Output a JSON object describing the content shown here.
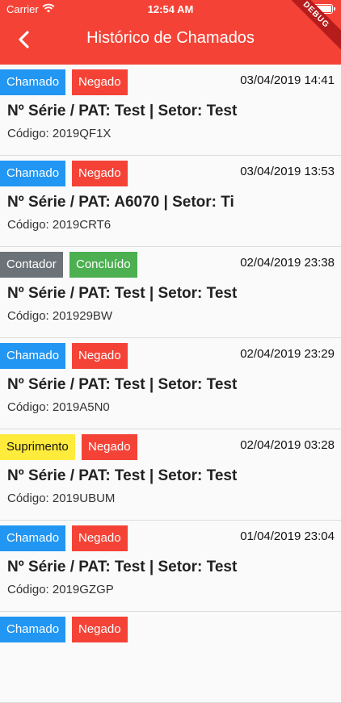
{
  "status_bar": {
    "carrier": "Carrier",
    "time": "12:54 AM"
  },
  "header": {
    "title": "Histórico de Chamados",
    "debug_label": "DEBUG"
  },
  "items": [
    {
      "badges": [
        {
          "label": "Chamado",
          "color": "#2196f3"
        },
        {
          "label": "Negado",
          "color": "#f44336"
        }
      ],
      "date": "03/04/2019 14:41",
      "line": "Nº Série / PAT: Test | Setor: Test",
      "code": "Código: 2019QF1X"
    },
    {
      "badges": [
        {
          "label": "Chamado",
          "color": "#2196f3"
        },
        {
          "label": "Negado",
          "color": "#f44336"
        }
      ],
      "date": "03/04/2019 13:53",
      "line": "Nº Série / PAT: A6070 | Setor: Ti",
      "code": "Código: 2019CRT6"
    },
    {
      "badges": [
        {
          "label": "Contador",
          "color": "#6b7278"
        },
        {
          "label": "Concluído",
          "color": "#4caf50"
        }
      ],
      "date": "02/04/2019 23:38",
      "line": "Nº Série / PAT: Test | Setor: Test",
      "code": "Código: 201929BW"
    },
    {
      "badges": [
        {
          "label": "Chamado",
          "color": "#2196f3"
        },
        {
          "label": "Negado",
          "color": "#f44336"
        }
      ],
      "date": "02/04/2019 23:29",
      "line": "Nº Série / PAT: Test | Setor: Test",
      "code": "Código: 2019A5N0"
    },
    {
      "badges": [
        {
          "label": "Suprimento",
          "color": "#ffeb3b"
        },
        {
          "label": "Negado",
          "color": "#f44336"
        }
      ],
      "date": "02/04/2019 03:28",
      "line": "Nº Série / PAT: Test | Setor: Test",
      "code": "Código: 2019UBUM"
    },
    {
      "badges": [
        {
          "label": "Chamado",
          "color": "#2196f3"
        },
        {
          "label": "Negado",
          "color": "#f44336"
        }
      ],
      "date": "01/04/2019 23:04",
      "line": "Nº Série / PAT: Test | Setor: Test",
      "code": "Código: 2019GZGP"
    },
    {
      "badges": [
        {
          "label": "Chamado",
          "color": "#2196f3"
        },
        {
          "label": "Negado",
          "color": "#f44336"
        }
      ],
      "date": "",
      "line": "",
      "code": ""
    }
  ],
  "colors": {
    "appbar": "#f44336"
  }
}
